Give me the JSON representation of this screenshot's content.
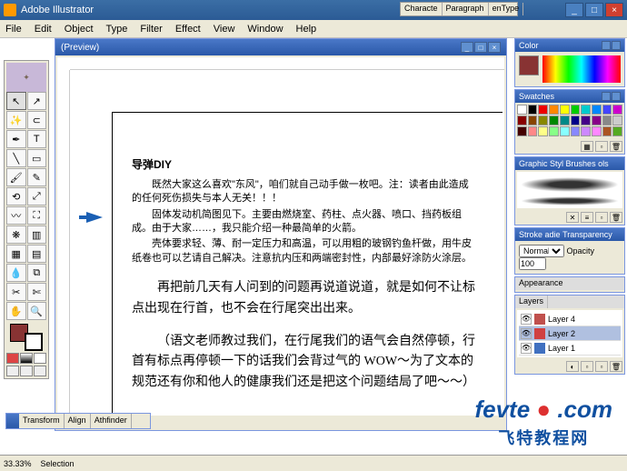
{
  "title": "Adobe Illustrator",
  "menus": [
    "File",
    "Edit",
    "Object",
    "Type",
    "Filter",
    "Effect",
    "View",
    "Window",
    "Help"
  ],
  "floatTabs": [
    "Characte",
    "Paragraph",
    "enType"
  ],
  "docTitle": "(Preview)",
  "article": {
    "heading": "导弹DIY",
    "p1": "既然大家这么喜欢\"东风\"，咱们就自己动手做一枚吧。注：读者由此造成的任何死伤损失与本人无关！！！",
    "p2": "固体发动机简图见下。主要由燃烧室、药柱、点火器、喷口、挡药板组成。由于大家……，我只能介绍一种最简单的火箭。",
    "p3": "壳体要求轻、薄、耐一定压力和高温，可以用粗的玻钢钓鱼杆做，用牛皮纸卷也可以艺请自己解决。注意抗内压和两端密封性，内部最好涂防火涂层。",
    "b1": "再把前几天有人问到的问题再说道说道，就是如何不让标点出现在行首，也不会在行尾突出出来。",
    "b2": "（语文老师教过我们，在行尾我们的语气会自然停顿，行首有标点再停顿一下的话我们会背过气的 WOW～为了文本的规范还有你和他人的健康我们还是把这个问题结局了吧～～）"
  },
  "status": {
    "zoom": "33.33%",
    "sel": "Selection"
  },
  "panels": {
    "color": "Color",
    "swatches": "Swatches",
    "styles": [
      "Graphic Styl",
      "Brushes",
      "ols"
    ],
    "stroke": [
      "Stroke",
      "adie",
      "Transparency"
    ],
    "normal": "Normal",
    "opacity": "Opacity",
    "opval": "100",
    "appearance": "Appearance",
    "layers": "Layers",
    "layerItems": [
      {
        "name": "Layer 4",
        "color": "#c0504d"
      },
      {
        "name": "Layer 2",
        "color": "#d04040"
      },
      {
        "name": "Layer 1",
        "color": "#4070c0"
      }
    ]
  },
  "botFloat": [
    "Transform",
    "Align",
    "Athfinder"
  ],
  "watermark": {
    "l1a": "fevte",
    "l1b": ".com",
    "l2": "飞特教程网"
  },
  "swColors": [
    [
      "#fff",
      "#000",
      "#e00",
      "#f80",
      "#ff0",
      "#0c0",
      "#0cc",
      "#08f",
      "#44f",
      "#c0c"
    ],
    [
      "#800",
      "#840",
      "#880",
      "#080",
      "#088",
      "#008",
      "#408",
      "#808",
      "#888",
      "#ccc"
    ],
    [
      "#400",
      "#f88",
      "#ff8",
      "#8f8",
      "#8ff",
      "#88f",
      "#c8f",
      "#f8f",
      "#a52",
      "#5a2"
    ]
  ]
}
